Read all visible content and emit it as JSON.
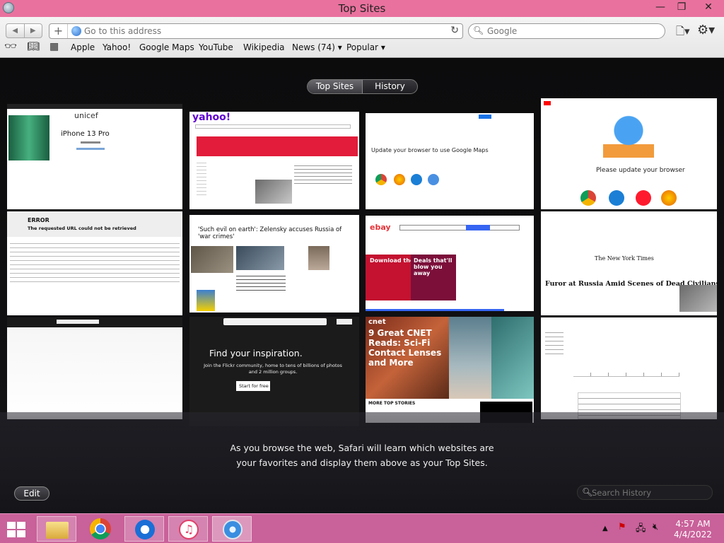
{
  "window": {
    "title": "Top Sites"
  },
  "toolbar": {
    "address_placeholder": "Go to this address",
    "search_placeholder": "Google"
  },
  "bookmarks": [
    {
      "label": "Apple"
    },
    {
      "label": "Yahoo!"
    },
    {
      "label": "Google Maps"
    },
    {
      "label": "YouTube"
    },
    {
      "label": "Wikipedia"
    },
    {
      "label": "News (74)",
      "dropdown": true
    },
    {
      "label": "Popular",
      "dropdown": true
    }
  ],
  "tabs": {
    "top_sites": "Top Sites",
    "history": "History"
  },
  "thumbnails": {
    "unicef": {
      "logo": "unicef",
      "heading": "iPhone 13 Pro"
    },
    "yahoo": {
      "logo": "yahoo!"
    },
    "google_maps": {
      "heading": "Update your browser to use Google Maps"
    },
    "youtube": {
      "heading": "Please update your browser"
    },
    "error": {
      "title": "ERROR",
      "subtitle": "The requested URL could not be retrieved"
    },
    "news": {
      "headline": "'Such evil on earth': Zelensky accuses Russia of 'war crimes'"
    },
    "ebay": {
      "logo": "ebay",
      "promo1": "Download the savings",
      "promo2": "Deals that'll blow you away"
    },
    "nytimes": {
      "masthead": "The New York Times",
      "headline": "Furor at Russia Amid Scenes of Dead Civilians"
    },
    "flickr": {
      "heading": "Find your inspiration.",
      "body": "Join the Flickr community, home to tens of billions of photos and 2 million groups.",
      "cta": "Start for free"
    },
    "cnet": {
      "logo": "cnet",
      "headline": "9 Great CNET Reads: Sci-Fi Contact Lenses and More",
      "more": "MORE TOP STORIES"
    }
  },
  "info_text": "As you browse the web, Safari will learn which websites are your favorites and display them above as your Top Sites.",
  "edit_label": "Edit",
  "search_history_placeholder": "Search History",
  "taskbar": {
    "time": "4:57 AM",
    "date": "4/4/2022"
  },
  "colors": {
    "titlebar": "#e8729d",
    "taskbar": "#c9619a",
    "yahoo": "#6001d2",
    "ebay_promo": "#c41230",
    "flickr_dark": "#1b1b1b"
  }
}
